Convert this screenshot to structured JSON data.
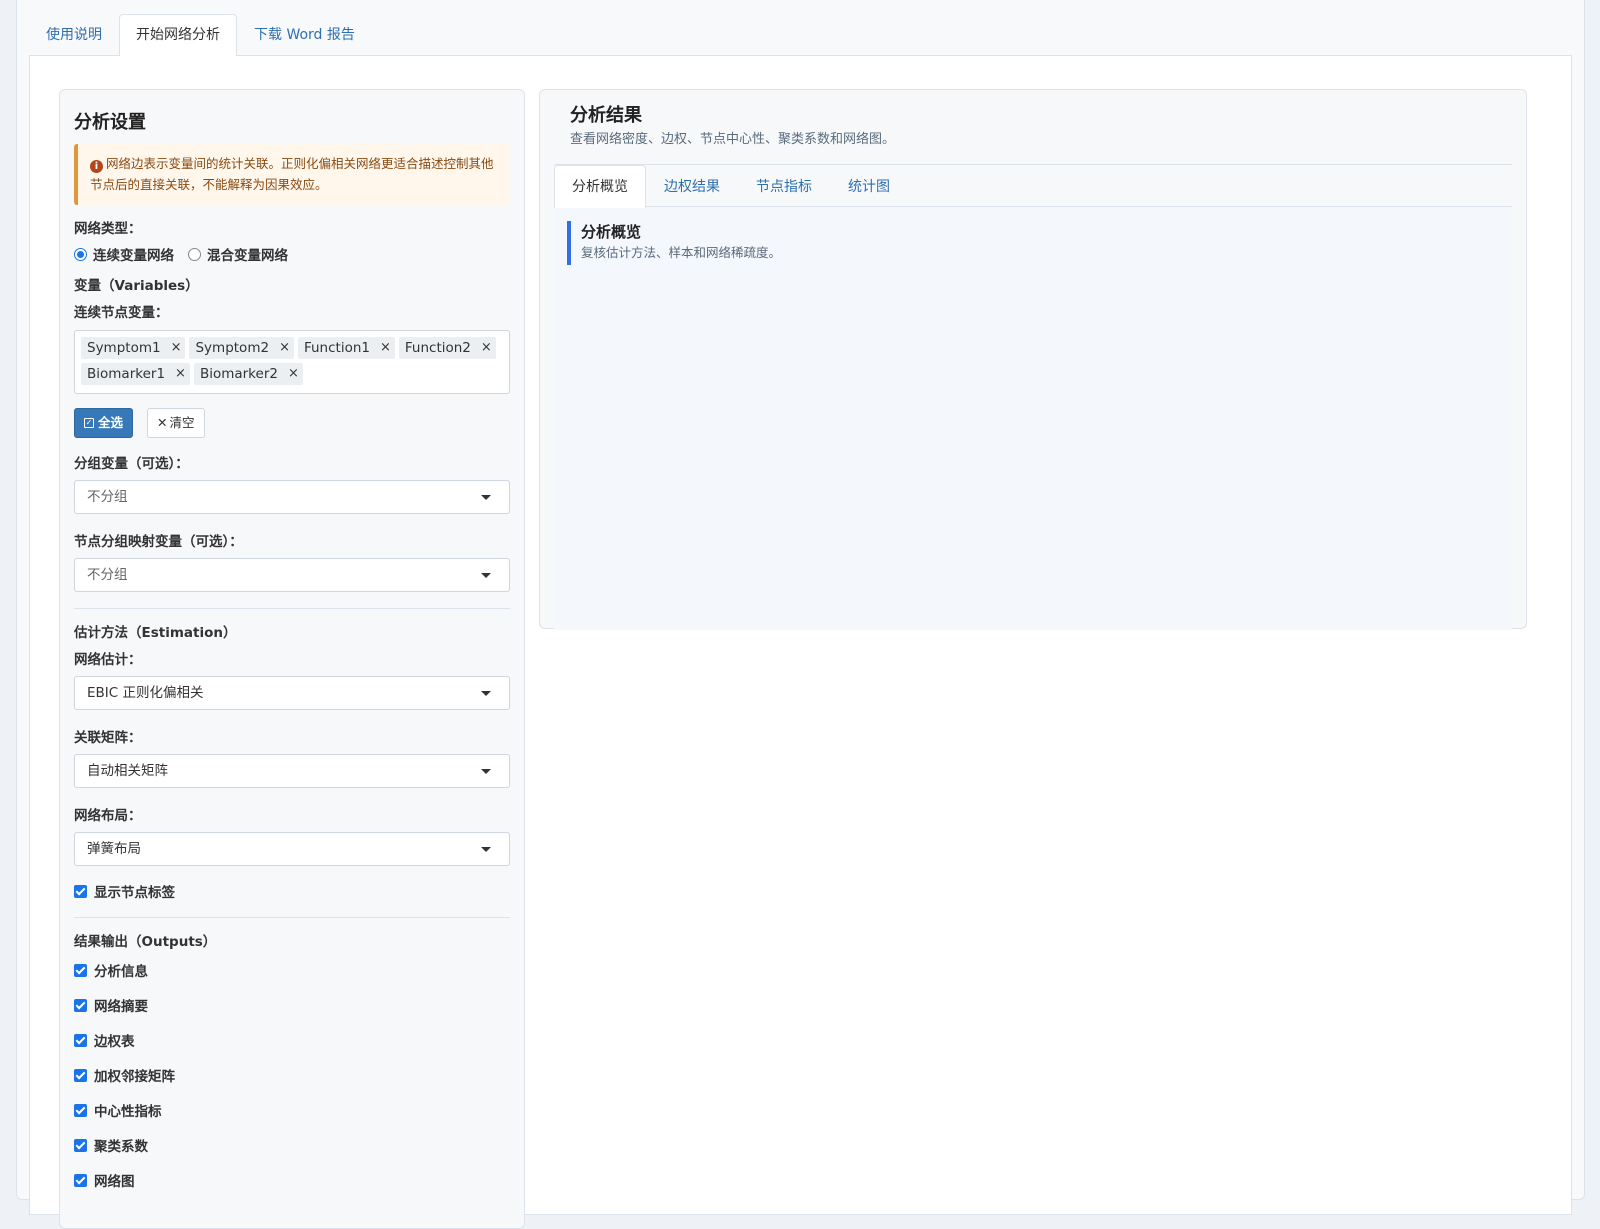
{
  "top_tabs": [
    {
      "label": "使用说明"
    },
    {
      "label": "开始网络分析"
    },
    {
      "label": "下载 Word 报告"
    }
  ],
  "settings": {
    "title": "分析设置",
    "alert": "网络边表示变量间的统计关联。正则化偏相关网络更适合描述控制其他节点后的直接关联，不能解释为因果效应。",
    "network_type_label": "网络类型：",
    "network_type_options": [
      "连续变量网络",
      "混合变量网络"
    ],
    "network_type_selected": "连续变量网络",
    "variables_section": "变量（Variables）",
    "continuous_label": "连续节点变量：",
    "continuous_tags": [
      "Symptom1",
      "Symptom2",
      "Function1",
      "Function2",
      "Biomarker1",
      "Biomarker2"
    ],
    "tag_remove_glyph": "×",
    "select_all": "全选",
    "clear": "清空",
    "clear_glyph": "✕",
    "group_label": "分组变量（可选）：",
    "group_value": "不分组",
    "node_group_label": "节点分组映射变量（可选）：",
    "node_group_value": "不分组",
    "estimation_section": "估计方法（Estimation）",
    "estimation_label": "网络估计：",
    "estimation_value": "EBIC 正则化偏相关",
    "matrix_label": "关联矩阵：",
    "matrix_value": "自动相关矩阵",
    "layout_label": "网络布局：",
    "layout_value": "弹簧布局",
    "show_labels": "显示节点标签",
    "outputs_section": "结果输出（Outputs）",
    "outputs": [
      "分析信息",
      "网络摘要",
      "边权表",
      "加权邻接矩阵",
      "中心性指标",
      "聚类系数",
      "网络图"
    ]
  },
  "results": {
    "title": "分析结果",
    "subtitle": "查看网络密度、边权、节点中心性、聚类系数和网络图。",
    "tabs": [
      {
        "label": "分析概览"
      },
      {
        "label": "边权结果"
      },
      {
        "label": "节点指标"
      },
      {
        "label": "统计图"
      }
    ],
    "overview_title": "分析概览",
    "overview_subtitle": "复核估计方法、样本和网络稀疏度。"
  },
  "colors": {
    "accent": "#1a73e8",
    "primary_button": "#3778b8",
    "link": "#2f6fb0",
    "alert_border": "#e0963b"
  }
}
